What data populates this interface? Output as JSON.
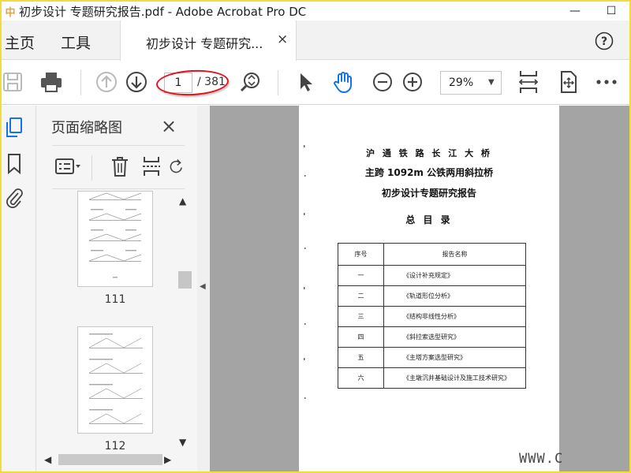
{
  "window": {
    "title": "初步设计 专题研究报告.pdf - Adobe Acrobat Pro DC",
    "minimize_glyph": "—",
    "restore_glyph": "☐"
  },
  "menu": {
    "home_label": "主页",
    "tools_label": "工具"
  },
  "tab": {
    "label": "初步设计 专题研究...",
    "close_glyph": "×"
  },
  "toolbar": {
    "current_page": "1",
    "total_pages": "/ 381",
    "zoom": "29%"
  },
  "thumbnails_panel": {
    "title": "页面缩略图",
    "close_glyph": "×",
    "pages": [
      {
        "label": "111"
      },
      {
        "label": "112"
      }
    ]
  },
  "document": {
    "heading_1": "沪 通 铁 路 长 江 大 桥",
    "heading_2": "主跨 1092m 公铁两用斜拉桥",
    "heading_3": "初步设计专题研究报告",
    "heading_4": "总 目 录",
    "table": {
      "headers": [
        "序号",
        "报告名称"
      ],
      "rows": [
        [
          "一",
          "《设计补充规定》"
        ],
        [
          "二",
          "《轨道形位分析》"
        ],
        [
          "三",
          "《结构非线性分析》"
        ],
        [
          "四",
          "《斜拉索选型研究》"
        ],
        [
          "五",
          "《主塔方案选型研究》"
        ],
        [
          "六",
          "《主墩沉井基础设计及施工技术研究》"
        ]
      ]
    }
  },
  "watermark": "WWW.C",
  "colors": {
    "accent_blue": "#1473e6",
    "annotation_red": "#e0141e",
    "frame_yellow": "#f2dc3a"
  }
}
